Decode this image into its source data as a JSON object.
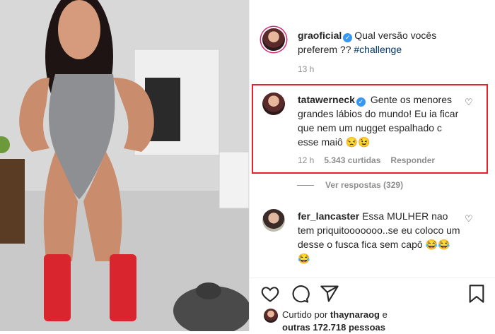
{
  "post": {
    "author": "graoficial",
    "caption": "Qual versão vocês preferem ?? ",
    "hashtag": "#challenge",
    "time": "13 h"
  },
  "comments": [
    {
      "user": "tatawerneck",
      "text": "Gente os menores grandes lábios do mundo! Eu ia ficar que nem um nugget espalhado c esse maiô 😒😉",
      "time": "12 h",
      "likes": "5.343 curtidas",
      "reply": "Responder",
      "highlighted": true
    },
    {
      "user": "fer_lancaster",
      "text": "Essa MULHER nao tem priquitooooooo..se eu coloco um desse o fusca fica sem capô 😂😂😂"
    }
  ],
  "view_replies": "Ver respostas (329)",
  "actions": {
    "like_icon": "heart-icon",
    "comment_icon": "comment-icon",
    "share_icon": "share-icon",
    "save_icon": "bookmark-icon"
  },
  "likes": {
    "prefix": "Curtido por ",
    "user": "thaynaraog",
    "suffix": " e",
    "others": "outras 172.718 pessoas"
  },
  "colors": {
    "highlight_border": "#e8202a",
    "verified": "#3897f0",
    "link": "#00376b"
  }
}
